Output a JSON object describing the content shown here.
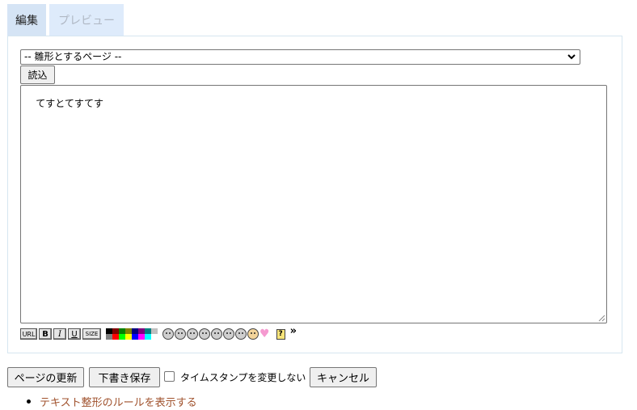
{
  "tabs": [
    {
      "label": "編集",
      "active": true
    },
    {
      "label": "プレビュー",
      "active": false
    }
  ],
  "template_select": {
    "selected": "-- 雛形とするページ --"
  },
  "load_button": "読込",
  "editor": {
    "content": "てすとてすてす"
  },
  "toolbar": {
    "url": "URL",
    "bold": "B",
    "italic": "I",
    "underline": "U",
    "size": "SIZE",
    "palette_colors": [
      "#000000",
      "#800000",
      "#008000",
      "#808000",
      "#000080",
      "#800080",
      "#008080",
      "#c0c0c0",
      "#808080",
      "#ff0000",
      "#00ff00",
      "#ffff00",
      "#0000ff",
      "#ff00ff",
      "#00ffff",
      "#ffffff"
    ],
    "face_icons": [
      "smile-icon",
      "bigsmile-icon",
      "tongue-icon",
      "oh-icon",
      "wink-icon",
      "sad-icon",
      "worried-icon",
      "blush-icon"
    ],
    "heart": "♥",
    "help": "?",
    "more": "»"
  },
  "actions": {
    "update": "ページの更新",
    "draft": "下書き保存",
    "timestamp_label": "タイムスタンプを変更しない",
    "timestamp_checked": false,
    "cancel": "キャンセル"
  },
  "rules_link": "テキスト整形のルールを表示する"
}
